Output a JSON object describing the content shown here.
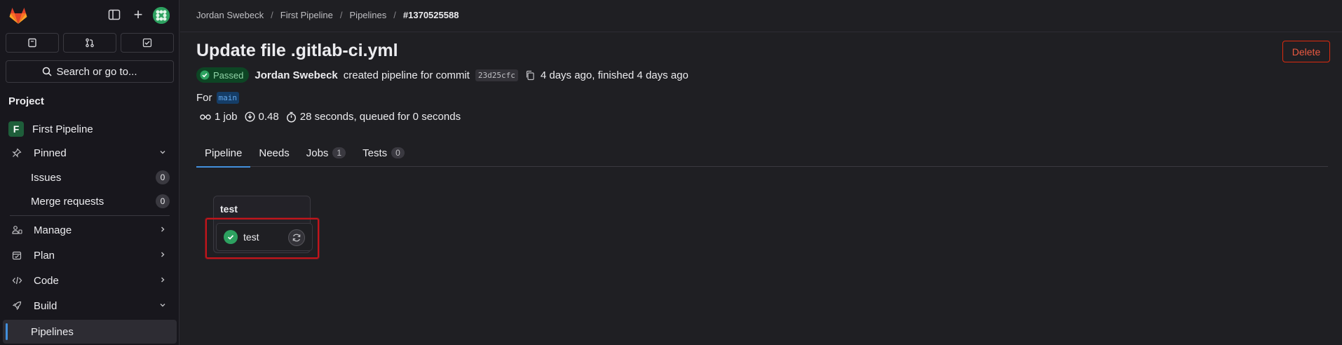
{
  "sidebar": {
    "search_label": "Search or go to...",
    "section_label": "Project",
    "project": {
      "initial": "F",
      "name": "First Pipeline"
    },
    "pinned_label": "Pinned",
    "issues_label": "Issues",
    "issues_count": "0",
    "merge_requests_label": "Merge requests",
    "merge_requests_count": "0",
    "manage_label": "Manage",
    "plan_label": "Plan",
    "code_label": "Code",
    "build_label": "Build",
    "pipelines_label": "Pipelines"
  },
  "breadcrumb": {
    "owner": "Jordan Swebeck",
    "project": "First Pipeline",
    "section": "Pipelines",
    "current": "#1370525588"
  },
  "pipeline": {
    "title": "Update file .gitlab-ci.yml",
    "delete_label": "Delete",
    "status": "Passed",
    "author": "Jordan Swebeck",
    "action_text": "created pipeline for commit",
    "commit_sha": "23d25cfc",
    "timing_text": "4 days ago, finished 4 days ago",
    "ref_prefix": "For",
    "ref": "main",
    "jobs_stat": "1 job",
    "coverage_stat": "0.48",
    "duration_stat": "28 seconds, queued for 0 seconds"
  },
  "tabs": [
    {
      "label": "Pipeline"
    },
    {
      "label": "Needs"
    },
    {
      "label": "Jobs",
      "count": "1"
    },
    {
      "label": "Tests",
      "count": "0"
    }
  ],
  "graph": {
    "stage_name": "test",
    "job_name": "test"
  },
  "colors": {
    "accent": "#428fdc",
    "success": "#2da160",
    "danger": "#dd2b0e"
  }
}
